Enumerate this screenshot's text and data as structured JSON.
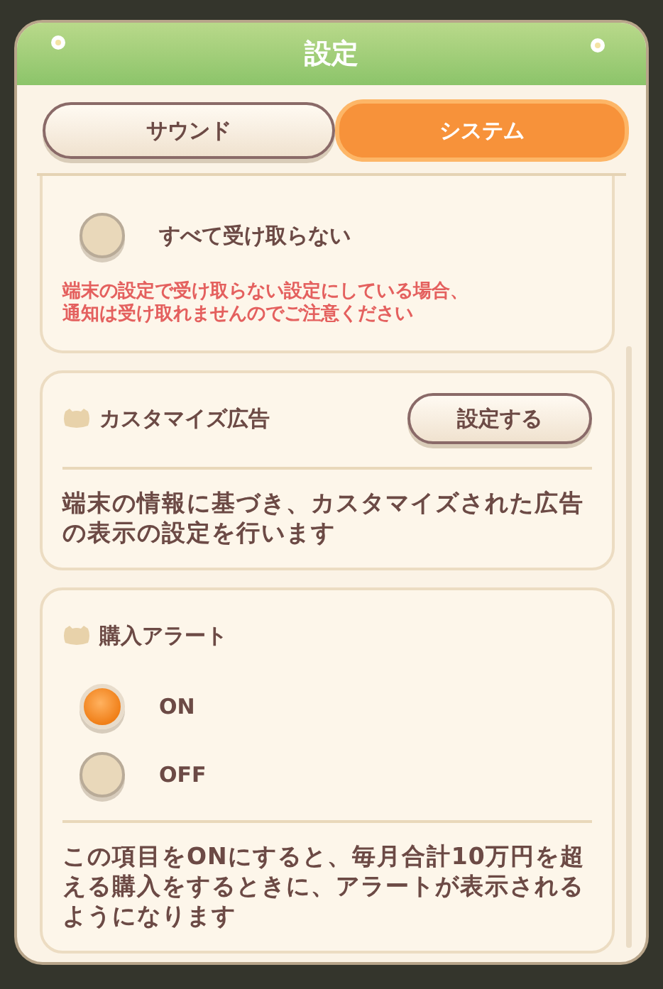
{
  "dialog": {
    "title": "設定"
  },
  "tabs": [
    {
      "label": "サウンド",
      "selected": false
    },
    {
      "label": "システム",
      "selected": true
    }
  ],
  "sections": [
    {
      "kind": "options",
      "options": [
        {
          "label": "すべて受け取らない",
          "selected": false
        }
      ],
      "note": "端末の設定で受け取らない設定にしている場合、通知は受け取れませんのでご注意ください"
    },
    {
      "kind": "button",
      "title": "カスタマイズ広告",
      "button": "設定する",
      "description": "端末の情報に基づき、カスタマイズされた広告の表示の設定を行います"
    },
    {
      "kind": "options",
      "title": "購入アラート",
      "options": [
        {
          "label": "ON",
          "selected": true
        },
        {
          "label": "OFF",
          "selected": false
        }
      ],
      "description": "この項目をONにすると、毎月合計10万円を超える購入をするときに、アラートが表示されるようになります"
    }
  ]
}
